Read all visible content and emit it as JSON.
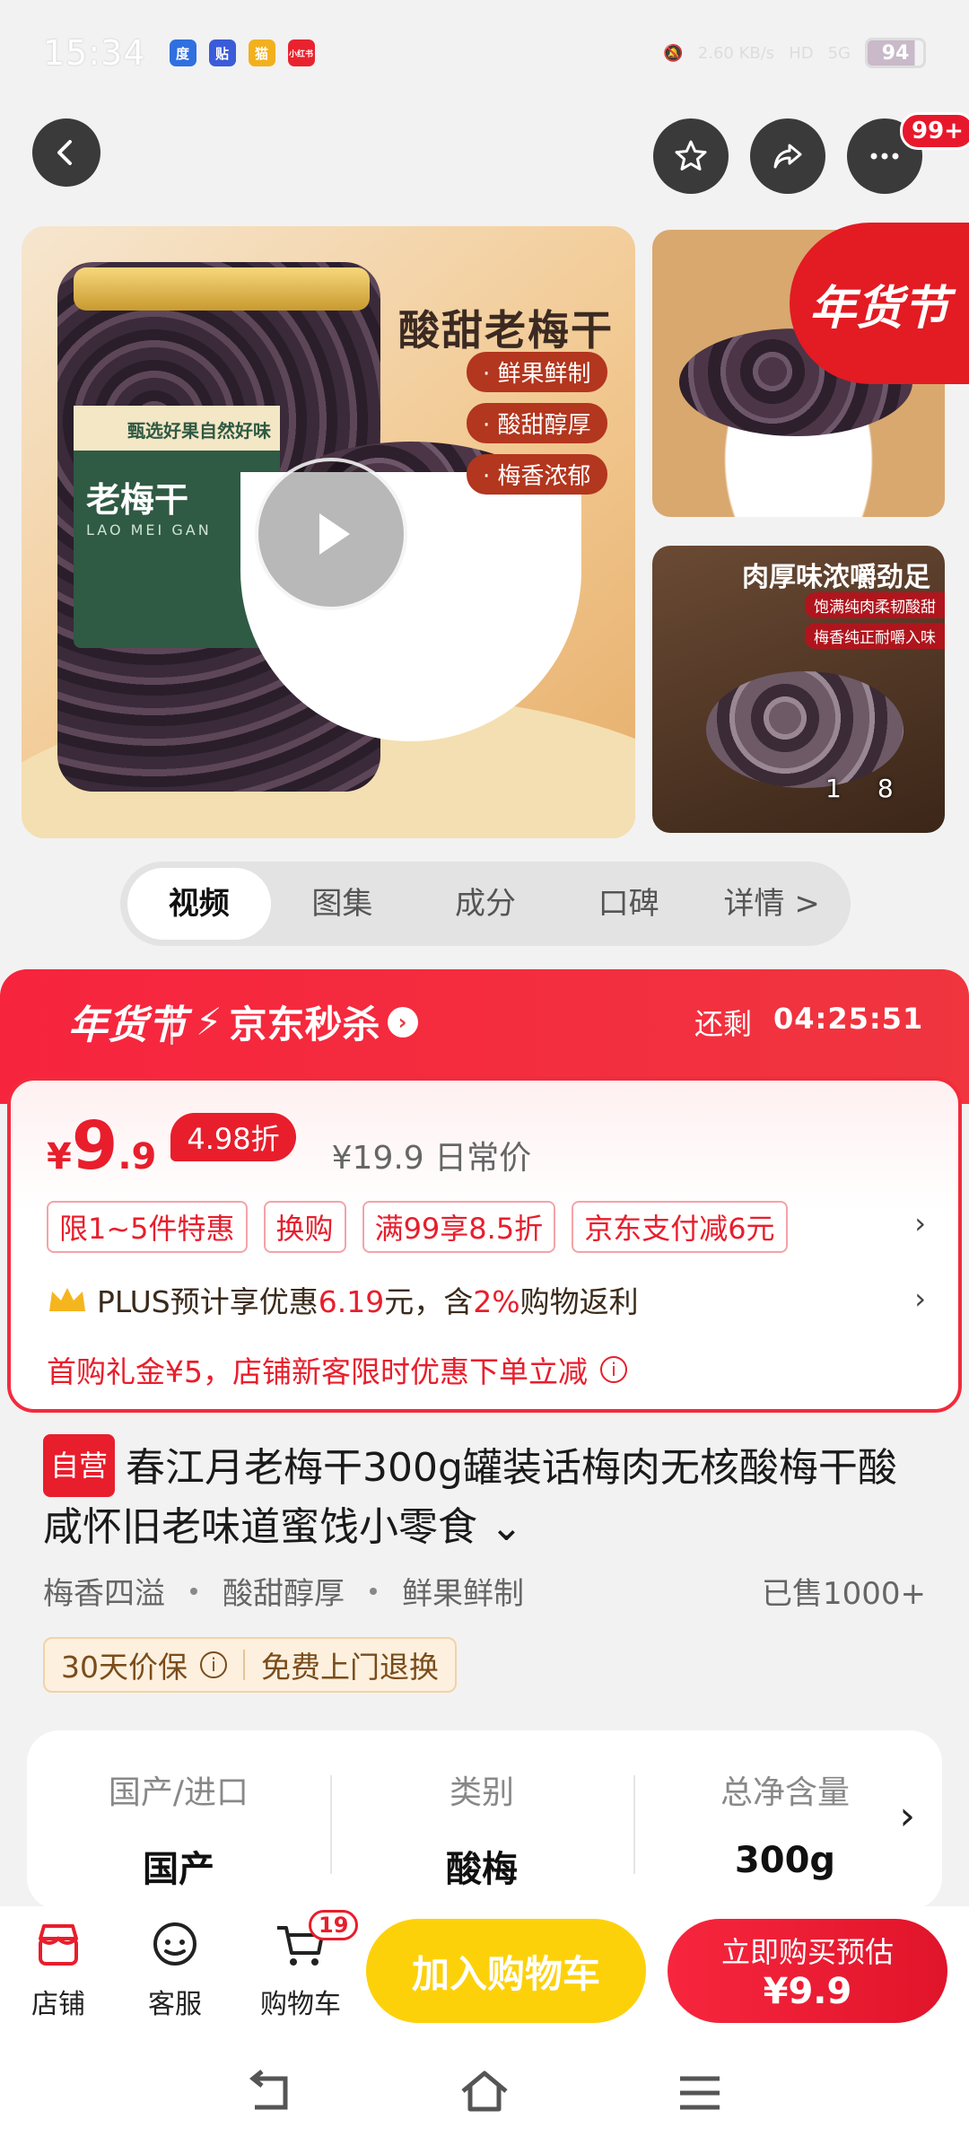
{
  "status_bar": {
    "time": "15:34",
    "apps": [
      "度",
      "贴",
      "猫",
      "小红书"
    ],
    "network_speed": "2.60 KB/s",
    "hd": "HD",
    "signal": "5G",
    "battery": "94"
  },
  "top_nav": {
    "more_badge": "99+"
  },
  "gallery": {
    "main_title": "酸甜老梅干",
    "main_tags": [
      "· 鲜果鲜制",
      "· 酸甜醇厚",
      "· 梅香浓郁"
    ],
    "jar_banner": "甄选好果自然好味",
    "jar_title": "老梅干",
    "jar_pinyin": "LAO MEI GAN",
    "side2_title": "肉厚味浓嚼劲足",
    "side2_tags": [
      "饱满纯肉柔韧酸甜",
      "梅香纯正耐嚼入味"
    ],
    "corner_badge": "年货节",
    "counter_current": "1",
    "counter_total": "8"
  },
  "tabs": [
    "视频",
    "图集",
    "成分",
    "口碑",
    "详情 >"
  ],
  "promo": {
    "festival": "年货节",
    "seckill": "京东秒杀",
    "remain_label": "还剩",
    "countdown": "04:25:51",
    "price_symbol": "¥",
    "price_int": "9",
    "price_dec": ".9",
    "discount": "4.98折",
    "original_price": "¥19.9 日常价",
    "tags": [
      "限1~5件特惠",
      "换购",
      "满99享8.5折",
      "京东支付减6元"
    ],
    "plus_prefix": "PLUS预计享优惠",
    "plus_amount": "6.19",
    "plus_mid": "元，含",
    "plus_percent": "2%",
    "plus_suffix": "购物返利",
    "gift_text": "首购礼金¥5，店铺新客限时优惠下单立减"
  },
  "product": {
    "self_tag": "自营",
    "title": "春江月老梅干300g罐装话梅肉无核酸梅干酸咸怀旧老味道蜜饯小零食",
    "features": [
      "梅香四溢",
      "酸甜醇厚",
      "鲜果鲜制"
    ],
    "sold": "已售1000+",
    "guarantee_1": "30天价保",
    "guarantee_2": "免费上门退换"
  },
  "specs": [
    {
      "label": "国产/进口",
      "value": "国产"
    },
    {
      "label": "类别",
      "value": "酸梅"
    },
    {
      "label": "总净含量",
      "value": "300g"
    }
  ],
  "bottom_bar": {
    "shop": "店铺",
    "service": "客服",
    "cart": "购物车",
    "cart_count": "19",
    "add_cart": "加入购物车",
    "buy_label": "立即购买预估",
    "buy_price": "¥9.9"
  },
  "colors": {
    "accent_red": "#e81e2c",
    "cart_yellow": "#fdd10a"
  }
}
